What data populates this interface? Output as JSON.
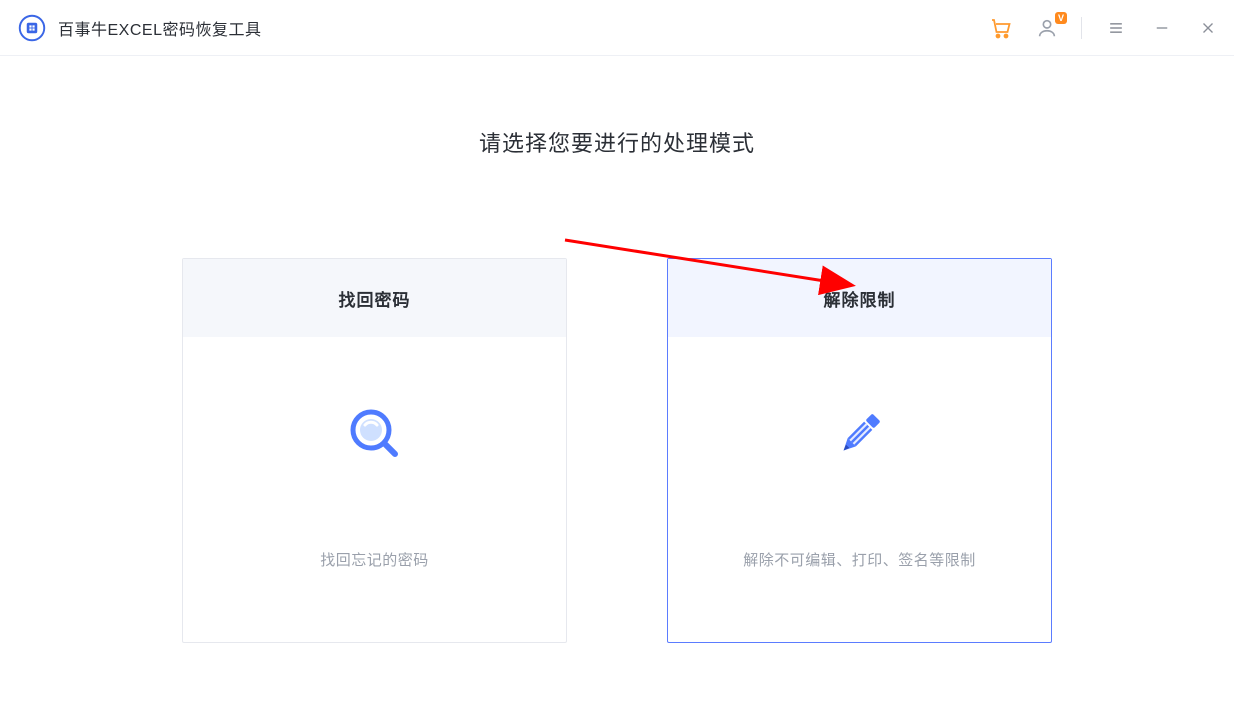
{
  "header": {
    "app_title": "百事牛EXCEL密码恢复工具",
    "vip_badge": "V"
  },
  "main": {
    "page_title": "请选择您要进行的处理模式",
    "cards": [
      {
        "title": "找回密码",
        "desc": "找回忘记的密码",
        "selected": false
      },
      {
        "title": "解除限制",
        "desc": "解除不可编辑、打印、签名等限制",
        "selected": true
      }
    ]
  }
}
